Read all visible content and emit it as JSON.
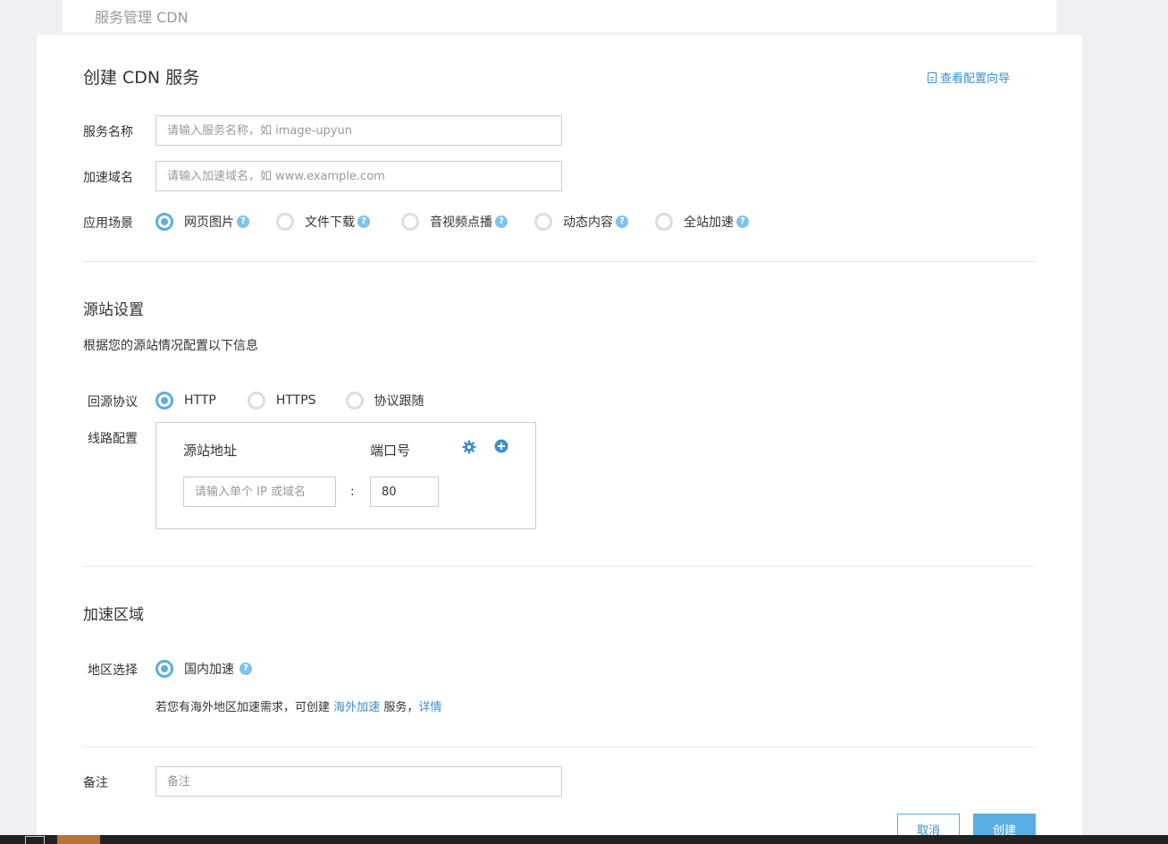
{
  "breadcrumb": "服务管理 CDN",
  "form": {
    "title": "创建 CDN 服务",
    "guide_link": "查看配置向导",
    "service_name": {
      "label": "服务名称",
      "placeholder": "请输入服务名称，如 image-upyun"
    },
    "domain": {
      "label": "加速域名",
      "placeholder": "请输入加速域名，如 www.example.com"
    },
    "scenario": {
      "label": "应用场景",
      "options": [
        "网页图片",
        "文件下载",
        "音视频点播",
        "动态内容",
        "全站加速"
      ],
      "selected": "网页图片"
    }
  },
  "origin": {
    "title": "源站设置",
    "description": "根据您的源站情况配置以下信息",
    "protocol": {
      "label": "回源协议",
      "options": [
        "HTTP",
        "HTTPS",
        "协议跟随"
      ],
      "selected": "HTTP"
    },
    "route": {
      "label": "线路配置",
      "col_address": "源站地址",
      "col_port": "端口号",
      "address_placeholder": "请输入单个 IP 或域名",
      "separator": ":",
      "port_value": "80"
    }
  },
  "region": {
    "title": "加速区域",
    "label": "地区选择",
    "option": "国内加速",
    "note_prefix": "若您有海外地区加速需求，可创建",
    "note_link": "海外加速",
    "note_middle": "服务，",
    "note_detail": "详情"
  },
  "remark": {
    "label": "备注",
    "placeholder": "备注"
  },
  "actions": {
    "cancel": "取消",
    "create": "创建"
  },
  "colors": {
    "accent": "#5aaee3",
    "link": "#3b8fd0",
    "help": "#7dc3ea"
  }
}
